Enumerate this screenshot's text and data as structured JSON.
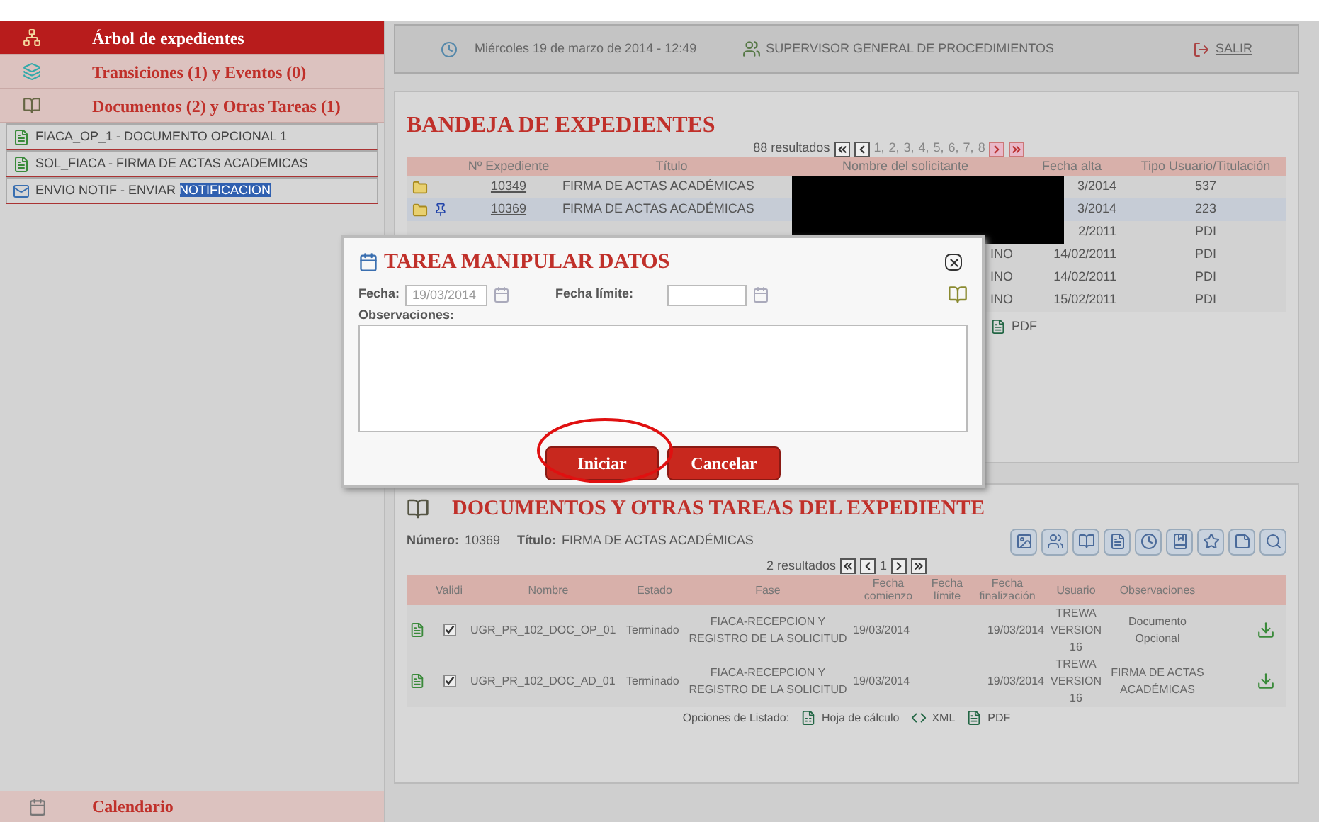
{
  "sidebar": {
    "sections": [
      {
        "label": "Árbol de expedientes",
        "selected": true
      },
      {
        "label": "Transiciones (1) y Eventos (0)",
        "selected": false
      },
      {
        "label": "Documentos (2) y Otras Tareas (1)",
        "selected": false
      }
    ],
    "documents": [
      {
        "label": "FIACA_OP_1 - DOCUMENTO OPCIONAL 1",
        "kind": "document"
      },
      {
        "label": "SOL_FIACA - FIRMA DE ACTAS ACADEMICAS",
        "kind": "document"
      },
      {
        "label": "ENVIO NOTIF - ENVIAR ",
        "highlighted": "NOTIFICACION",
        "kind": "task"
      }
    ],
    "footer": "Calendario"
  },
  "header": {
    "date": "Miércoles 19 de marzo de 2014 - 12:49",
    "user": "SUPERVISOR GENERAL DE PROCEDIMIENTOS",
    "logout": "SALIR"
  },
  "bandeja": {
    "title": "BANDEJA DE EXPEDIENTES",
    "results": "88 resultados",
    "pages": [
      "1,",
      "2,",
      "3,",
      "4,",
      "5,",
      "6,",
      "7,",
      "8"
    ],
    "columns": [
      "Nº Expediente",
      "Título",
      "Nombre del solicitante",
      "Fecha alta",
      "Tipo Usuario/Titulación"
    ],
    "rows": [
      {
        "expediente": "10349",
        "titulo": "FIRMA DE ACTAS ACADÉMICAS",
        "redacted": true,
        "fecha": "3/2014",
        "tipo": "537",
        "pinned": false,
        "selected": false
      },
      {
        "expediente": "10369",
        "titulo": "FIRMA DE ACTAS ACADÉMICAS",
        "redacted": true,
        "fecha": "3/2014",
        "tipo": "223",
        "pinned": true,
        "selected": true
      },
      {
        "redacted": true,
        "fecha": "2/2011",
        "tipo": "PDI",
        "pinned": false,
        "selected": false
      },
      {
        "redacted": false,
        "solicitante": "INO",
        "fecha": "14/02/2011",
        "tipo": "PDI",
        "pinned": false,
        "selected": false
      },
      {
        "redacted": false,
        "solicitante": "INO",
        "fecha": "14/02/2011",
        "tipo": "PDI",
        "pinned": false,
        "selected": false
      },
      {
        "redacted": false,
        "solicitante": "INO",
        "fecha": "15/02/2011",
        "tipo": "PDI",
        "pinned": false,
        "selected": false
      }
    ],
    "export": "PDF"
  },
  "dialog": {
    "title": "TAREA MANIPULAR DATOS",
    "fecha_label": "Fecha:",
    "fecha_value": "19/03/2014",
    "limite_label": "Fecha límite:",
    "observaciones_label": "Observaciones:",
    "buttons": [
      "Iniciar",
      "Cancelar"
    ]
  },
  "documentos": {
    "title": "DOCUMENTOS Y OTRAS TAREAS DEL EXPEDIENTE",
    "numero_label": "Número:",
    "numero": "10369",
    "titulo_label": "Título:",
    "titulo": "FIRMA DE ACTAS ACADÉMICAS",
    "results": "2 resultados",
    "page": "1",
    "columns": [
      "Validi",
      "Nombre",
      "Estado",
      "Fase",
      "Fecha comienzo",
      "Fecha límite",
      "Fecha finalización",
      "Usuario",
      "Observaciones"
    ],
    "rows": [
      {
        "checked": true,
        "nombre": "UGR_PR_102_DOC_OP_01",
        "estado": "Terminado",
        "fase": "FIACA-RECEPCION Y REGISTRO DE LA SOLICITUD",
        "comienzo": "19/03/2014",
        "fin": "19/03/2014",
        "usuario": "TREWA VERSION 16",
        "observaciones": "Documento Opcional"
      },
      {
        "checked": true,
        "nombre": "UGR_PR_102_DOC_AD_01",
        "estado": "Terminado",
        "fase": "FIACA-RECEPCION Y REGISTRO DE LA SOLICITUD",
        "comienzo": "19/03/2014",
        "fin": "19/03/2014",
        "usuario": "TREWA VERSION 16",
        "observaciones": "FIRMA DE ACTAS ACADÉMICAS"
      }
    ],
    "options_label": "Opciones de Listado:",
    "options": [
      "Hoja de cálculo",
      "XML",
      "PDF"
    ]
  }
}
